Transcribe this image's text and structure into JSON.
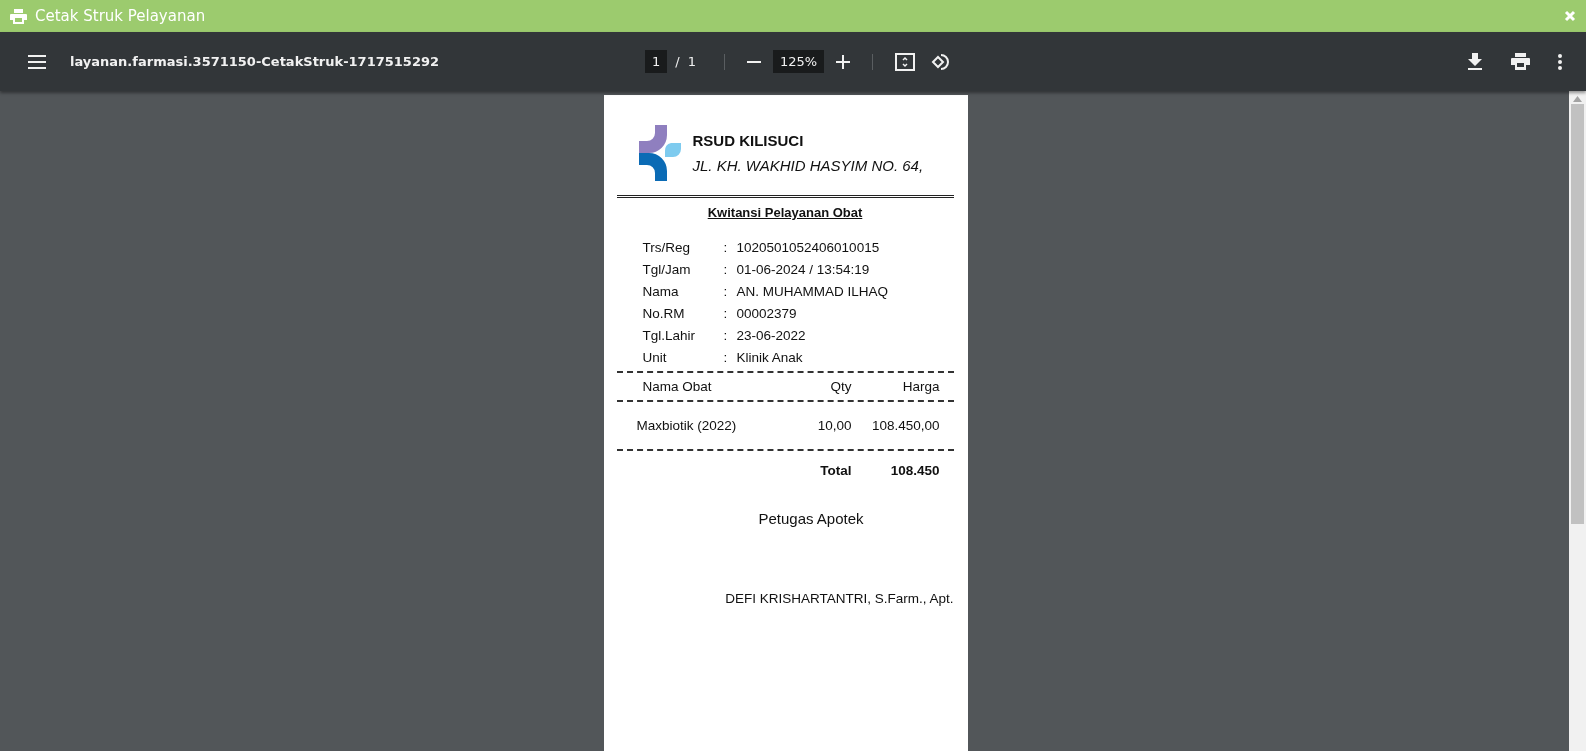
{
  "window": {
    "title": "Cetak Struk Pelayanan"
  },
  "viewer": {
    "filename": "layanan.farmasi.3571150-CetakStruk-1717515292",
    "page": "1",
    "page_total": "1",
    "separator": "/",
    "zoom": "125%"
  },
  "receipt": {
    "hospital": "RSUD KILISUCI",
    "address": "JL. KH. WAKHID HASYIM NO. 64,",
    "heading": "Kwitansi Pelayanan Obat",
    "info": [
      {
        "label": "Trs/Reg",
        "value": "1020501052406010015"
      },
      {
        "label": "Tgl/Jam",
        "value": "01-06-2024 / 13:54:19"
      },
      {
        "label": "Nama",
        "value": "AN. MUHAMMAD ILHAQ"
      },
      {
        "label": "No.RM",
        "value": "00002379"
      },
      {
        "label": "Tgl.Lahir",
        "value": "23-06-2022"
      },
      {
        "label": "Unit",
        "value": "Klinik Anak"
      }
    ],
    "colon": ":",
    "columns": [
      "Nama Obat",
      "Qty",
      "Harga"
    ],
    "items": [
      {
        "name": "Maxbiotik (2022)",
        "qty": "10,00",
        "price": "108.450,00"
      }
    ],
    "total_label": "Total",
    "total": "108.450",
    "signer_role": "Petugas Apotek",
    "signer_name": "DEFI KRISHARTANTRI, S.Farm., Apt."
  }
}
